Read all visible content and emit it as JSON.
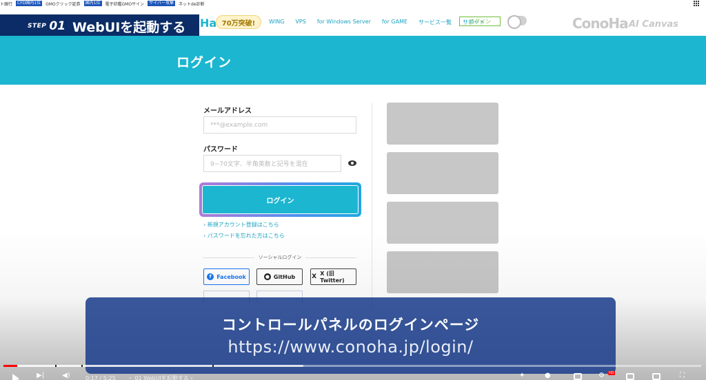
{
  "ticker": {
    "items": [
      {
        "text": "ト銀行",
        "tag": false
      },
      {
        "text": "CFD国内1位",
        "tag": true
      },
      {
        "text": "GMOクリック証券",
        "tag": false
      },
      {
        "text": "国内1位",
        "tag": true
      },
      {
        "text": "電子印鑑GMOサイン",
        "tag": false
      },
      {
        "text": "サイバー攻撃",
        "tag": true
      },
      {
        "text": "ネットde診断",
        "tag": false
      }
    ]
  },
  "step": {
    "prefix": "STEP",
    "number": "01",
    "title": "WebUIを起動する"
  },
  "nav": {
    "brand_partial": "Ha",
    "promo": "70万突破!",
    "links": [
      "WING",
      "VPS",
      "for Windows Server",
      "for GAME",
      "サービス一覧",
      "サポート"
    ],
    "login": "ログイン",
    "logo": "ConoHa",
    "ai_canvas": "AI Canvas"
  },
  "page": {
    "title": "ログイン"
  },
  "form": {
    "email_label": "メールアドレス",
    "email_placeholder": "***@example.com",
    "password_label": "パスワード",
    "password_placeholder": "9~70文字、半角英数と記号を混在",
    "login_button": "ログイン",
    "register_link": "新規アカウント登録はこちら",
    "forgot_link": "パスワードを忘れた方はこちら",
    "social_label": "ソーシャルログイン",
    "social_buttons": [
      "Facebook",
      "GitHub",
      "X (旧Twitter)"
    ]
  },
  "caption": {
    "title": "コントロールパネルのログインページ",
    "url": "https://www.conoha.jp/login/"
  },
  "player": {
    "time": "0:17 / 5:25",
    "chapter": "・ 01 WebUIを起動する ›",
    "progress": 0.02,
    "buffered": 0.43
  }
}
